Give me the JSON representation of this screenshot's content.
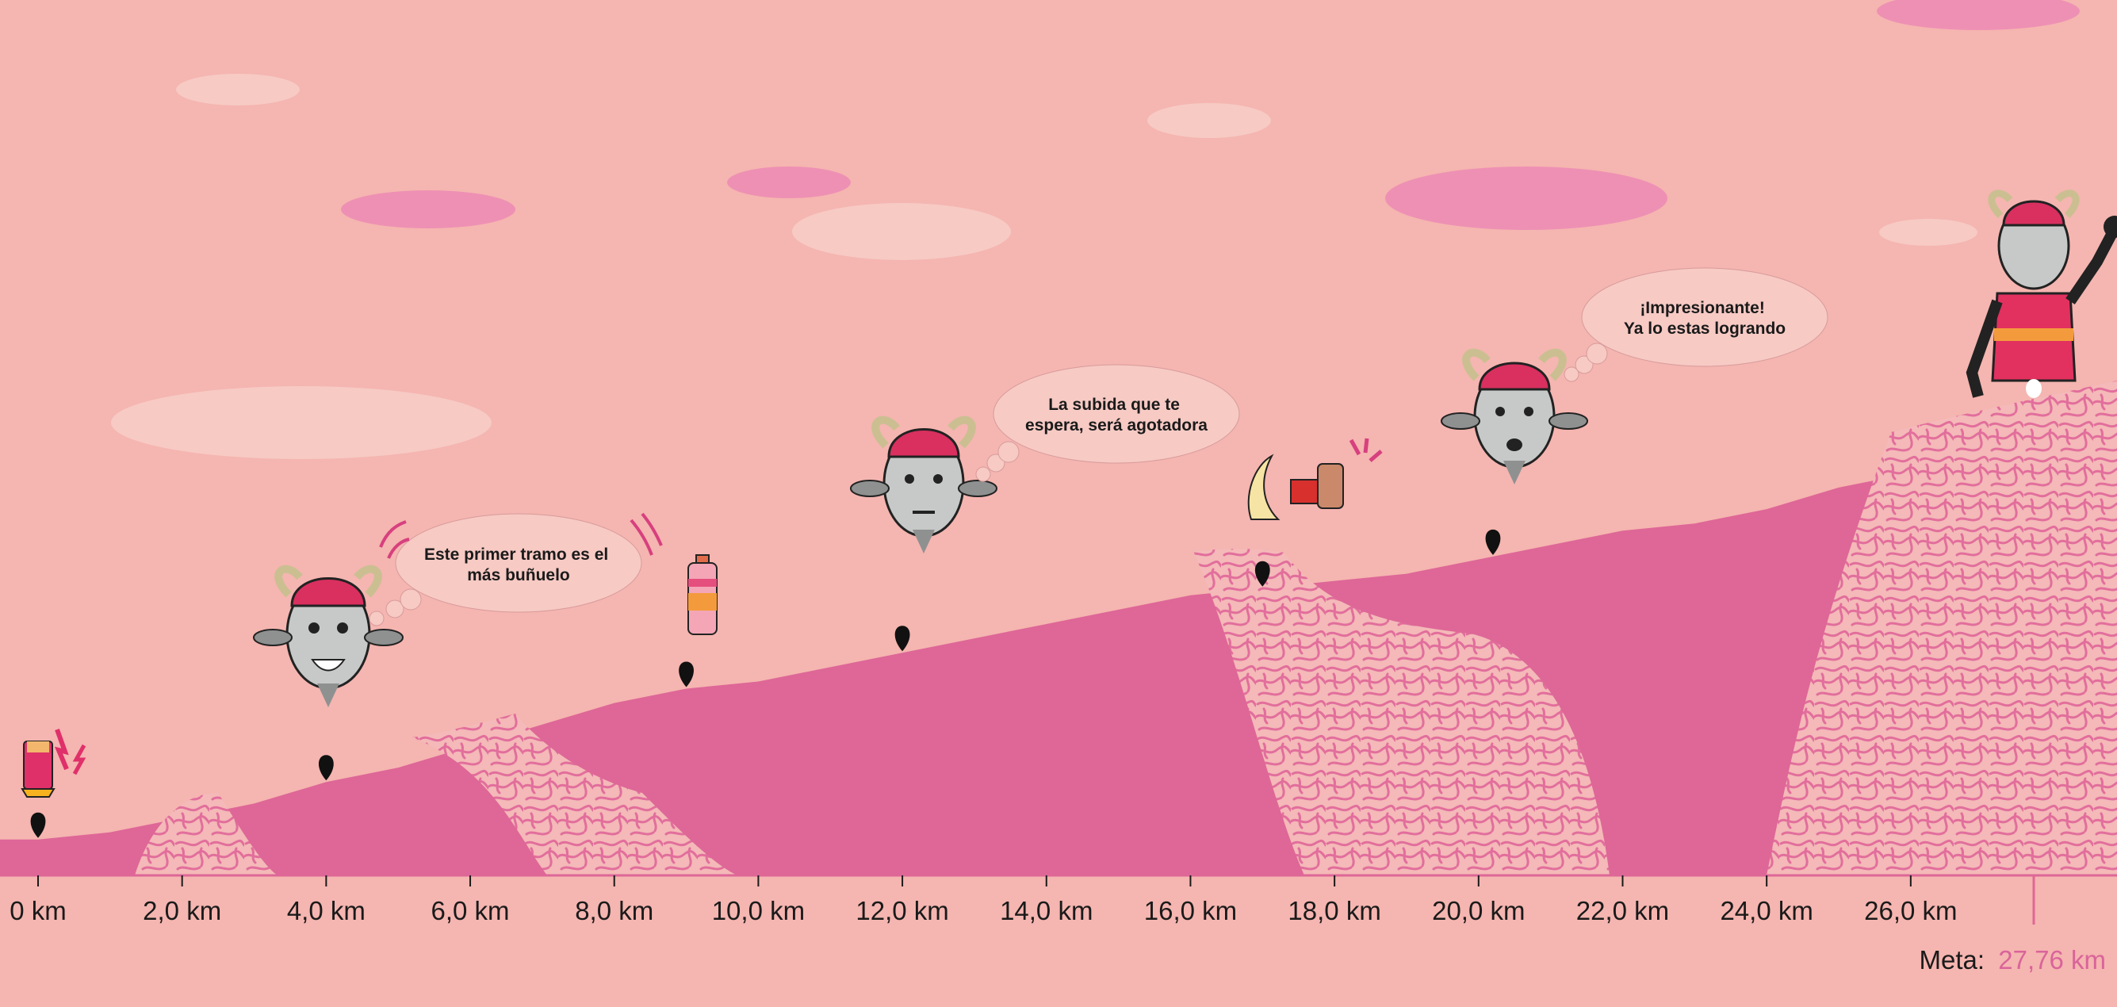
{
  "chart_data": {
    "type": "area",
    "x_unit": "km",
    "xlim": [
      0,
      27.76
    ],
    "x_ticks": [
      0,
      2,
      4,
      6,
      8,
      10,
      12,
      14,
      16,
      18,
      20,
      22,
      24,
      26
    ],
    "x_tick_labels": [
      "0 km",
      "2,0 km",
      "4,0 km",
      "6,0 km",
      "8,0 km",
      "10,0 km",
      "12,0 km",
      "14,0 km",
      "16,0 km",
      "18,0 km",
      "20,0 km",
      "22,0 km",
      "24,0 km",
      "26,0 km"
    ],
    "elevation_profile": {
      "x": [
        0,
        1.0,
        2.0,
        3.0,
        4.0,
        5.0,
        6.0,
        7.0,
        8.0,
        9.0,
        10.0,
        11.0,
        12.0,
        13.0,
        14.0,
        15.0,
        16.0,
        17.0,
        18.0,
        19.0,
        20.0,
        21.0,
        22.0,
        23.0,
        24.0,
        25.0,
        26.0,
        27.0,
        27.76
      ],
      "y": [
        5,
        6,
        8,
        10,
        13,
        15,
        18,
        21,
        24,
        26,
        27,
        29,
        31,
        33,
        35,
        37,
        39,
        40,
        41,
        42,
        44,
        46,
        48,
        49,
        51,
        54,
        56,
        59,
        61
      ]
    },
    "markers": [
      {
        "km": 0,
        "item": "energy-bar"
      },
      {
        "km": 4.0,
        "item": "goat"
      },
      {
        "km": 9.0,
        "item": "water-bottle"
      },
      {
        "km": 12.0,
        "item": "goat"
      },
      {
        "km": 17.0,
        "item": "food"
      },
      {
        "km": 20.2,
        "item": "goat"
      },
      {
        "km": 27.76,
        "item": "goat-finish"
      }
    ],
    "speech_bubbles": [
      "Este primer tramo es el\nmás buñuelo",
      "La subida que te\nespera, será agotadora",
      "¡Impresionante!\nYa lo estas logrando"
    ],
    "meta_label": "Meta:",
    "meta_value": "27,76 km"
  },
  "colors": {
    "background": "#f5b5b0",
    "profile": "#de6797",
    "texture": "#f7c2bb",
    "cloud_light": "#f7cac4",
    "cloud_pink": "#ee90b4",
    "accent": "#d7407e",
    "marker": "#111111",
    "meta_value": "#d9649a"
  }
}
